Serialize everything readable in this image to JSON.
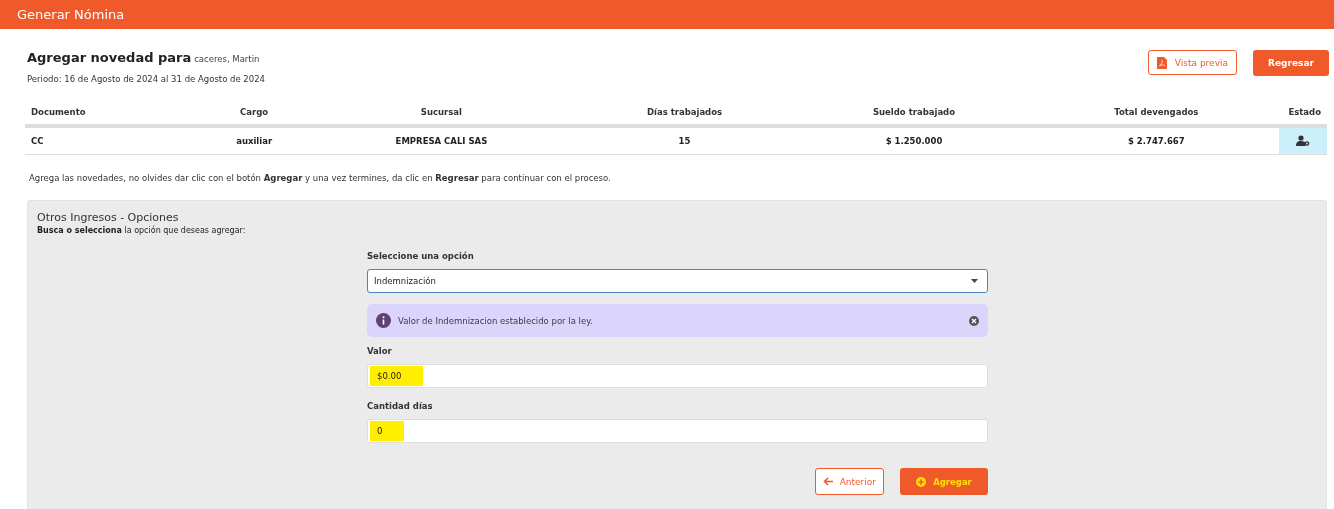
{
  "window": {
    "title": "Generar Nómina"
  },
  "heading": {
    "title": "Agregar novedad para",
    "employee": "caceres, Martin",
    "period": "Periodo: 16 de Agosto de 2024 al 31 de Agosto de 2024"
  },
  "actions": [
    {
      "kind": "outline",
      "label": "Vista previa"
    },
    {
      "kind": "solid",
      "label": "Regresar"
    }
  ],
  "table": {
    "columns": [
      "Documento",
      "Cargo",
      "Sucursal",
      "Días trabajados",
      "Sueldo trabajado",
      "Total devengados",
      "Estado"
    ],
    "rows": [
      {
        "cells": [
          "CC",
          "auxiliar",
          "EMPRESA CALI SAS",
          "15",
          "$ 1.250.000",
          "$ 2.747.667"
        ]
      }
    ]
  },
  "instructions": "Agrega las novedades, no olvides dar clic con el botón **Agregar** y una vez termines, da clic en **Regresar** para continuar con el proceso.",
  "panel": {
    "title": "Otros Ingresos - Opciones",
    "subtitle": "**Busca o selecciona** la opción que deseas agregar:",
    "select": {
      "label": "Seleccione una opción",
      "value": "Indemnización"
    },
    "alert": {
      "text": "Valor de Indemnizacion establecido por la ley."
    },
    "fields": [
      {
        "label": "Valor",
        "value": "$0.00",
        "highlighted": true
      },
      {
        "label": "Cantidad días",
        "value": "0",
        "highlighted": true
      }
    ],
    "buttons": [
      {
        "kind": "back",
        "label": "Anterior"
      },
      {
        "kind": "add",
        "label": "Agregar"
      }
    ]
  }
}
